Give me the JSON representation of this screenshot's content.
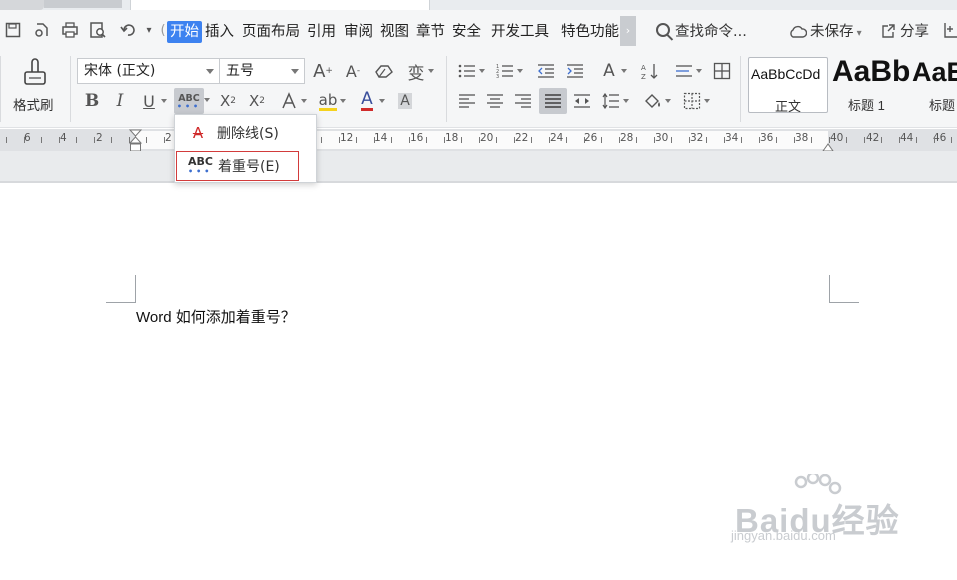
{
  "menubar": {
    "tabs": [
      "开始",
      "插入",
      "页面布局",
      "引用",
      "审阅",
      "视图",
      "章节",
      "安全",
      "开发工具",
      "特色功能"
    ],
    "active_tab": "开始",
    "search_label": "查找命令...",
    "unsaved_label": "未保存",
    "share_label": "分享"
  },
  "ribbon": {
    "format_painter_label": "格式刷",
    "font_name": "宋体 (正文)",
    "font_size": "五号",
    "bold_glyph": "B",
    "italic_glyph": "I",
    "underline_glyph": "U",
    "emphasis_button_glyph": "ABC",
    "styles": [
      {
        "sample": "AaBbCcDd",
        "label": "正文"
      },
      {
        "sample": "AaBb",
        "label": "标题 1"
      },
      {
        "sample": "AaE",
        "label": "标题"
      }
    ]
  },
  "ruler": {
    "labels": [
      "6",
      "4",
      "2",
      "2",
      "12",
      "14",
      "16",
      "18",
      "20",
      "22",
      "24",
      "26",
      "28",
      "30",
      "32",
      "34",
      "36",
      "38",
      "40",
      "42",
      "44",
      "46"
    ]
  },
  "dropdown": {
    "items": [
      {
        "icon": "A",
        "label": "删除线(S)"
      },
      {
        "icon": "ABC",
        "label": "着重号(E)"
      }
    ]
  },
  "document": {
    "text": "Word 如何添加着重号？"
  },
  "watermark": {
    "main": "Baidu经验",
    "sub": "jingyan.baidu.com"
  }
}
